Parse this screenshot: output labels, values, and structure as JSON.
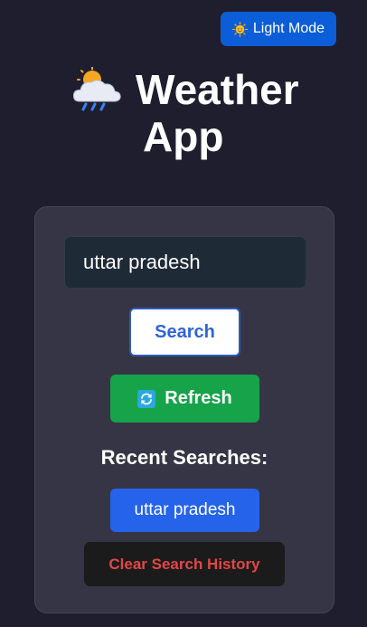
{
  "theme_toggle": {
    "icon": "sun-face-icon",
    "label": "Light Mode"
  },
  "header": {
    "icon": "sun-behind-rain-cloud-icon",
    "title_line1": "Weather",
    "title_line2": "App"
  },
  "search": {
    "value": "uttar pradesh",
    "button_label": "Search"
  },
  "refresh": {
    "icon": "refresh-arrows-icon",
    "label": "Refresh"
  },
  "recent": {
    "heading": "Recent Searches:",
    "items": [
      {
        "label": "uttar pradesh"
      }
    ],
    "clear_label": "Clear Search History"
  },
  "colors": {
    "background": "#1f1e2f",
    "card": "#363545",
    "accent_blue": "#2563eb",
    "toggle_blue": "#0b5ed7",
    "refresh_green": "#16a34a",
    "danger_red": "#e24747"
  }
}
